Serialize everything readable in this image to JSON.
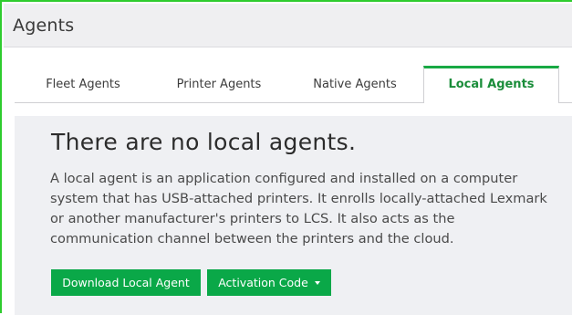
{
  "page": {
    "title": "Agents"
  },
  "tabs": [
    {
      "label": "Fleet Agents",
      "active": false
    },
    {
      "label": "Printer Agents",
      "active": false
    },
    {
      "label": "Native Agents",
      "active": false
    },
    {
      "label": "Local Agents",
      "active": true
    }
  ],
  "empty_state": {
    "title": "There are no local agents.",
    "description": "A local agent is an application configured and installed on a computer system that has USB-attached printers. It enrolls locally-attached Lexmark or another manufacturer's printers to LCS. It also acts as the communication channel between the printers and the cloud."
  },
  "actions": {
    "download_label": "Download Local Agent",
    "activation_label": "Activation Code"
  },
  "colors": {
    "accent": "#0aa848",
    "frame": "#2ecc2e",
    "active_tab_text": "#1a8d3a"
  }
}
